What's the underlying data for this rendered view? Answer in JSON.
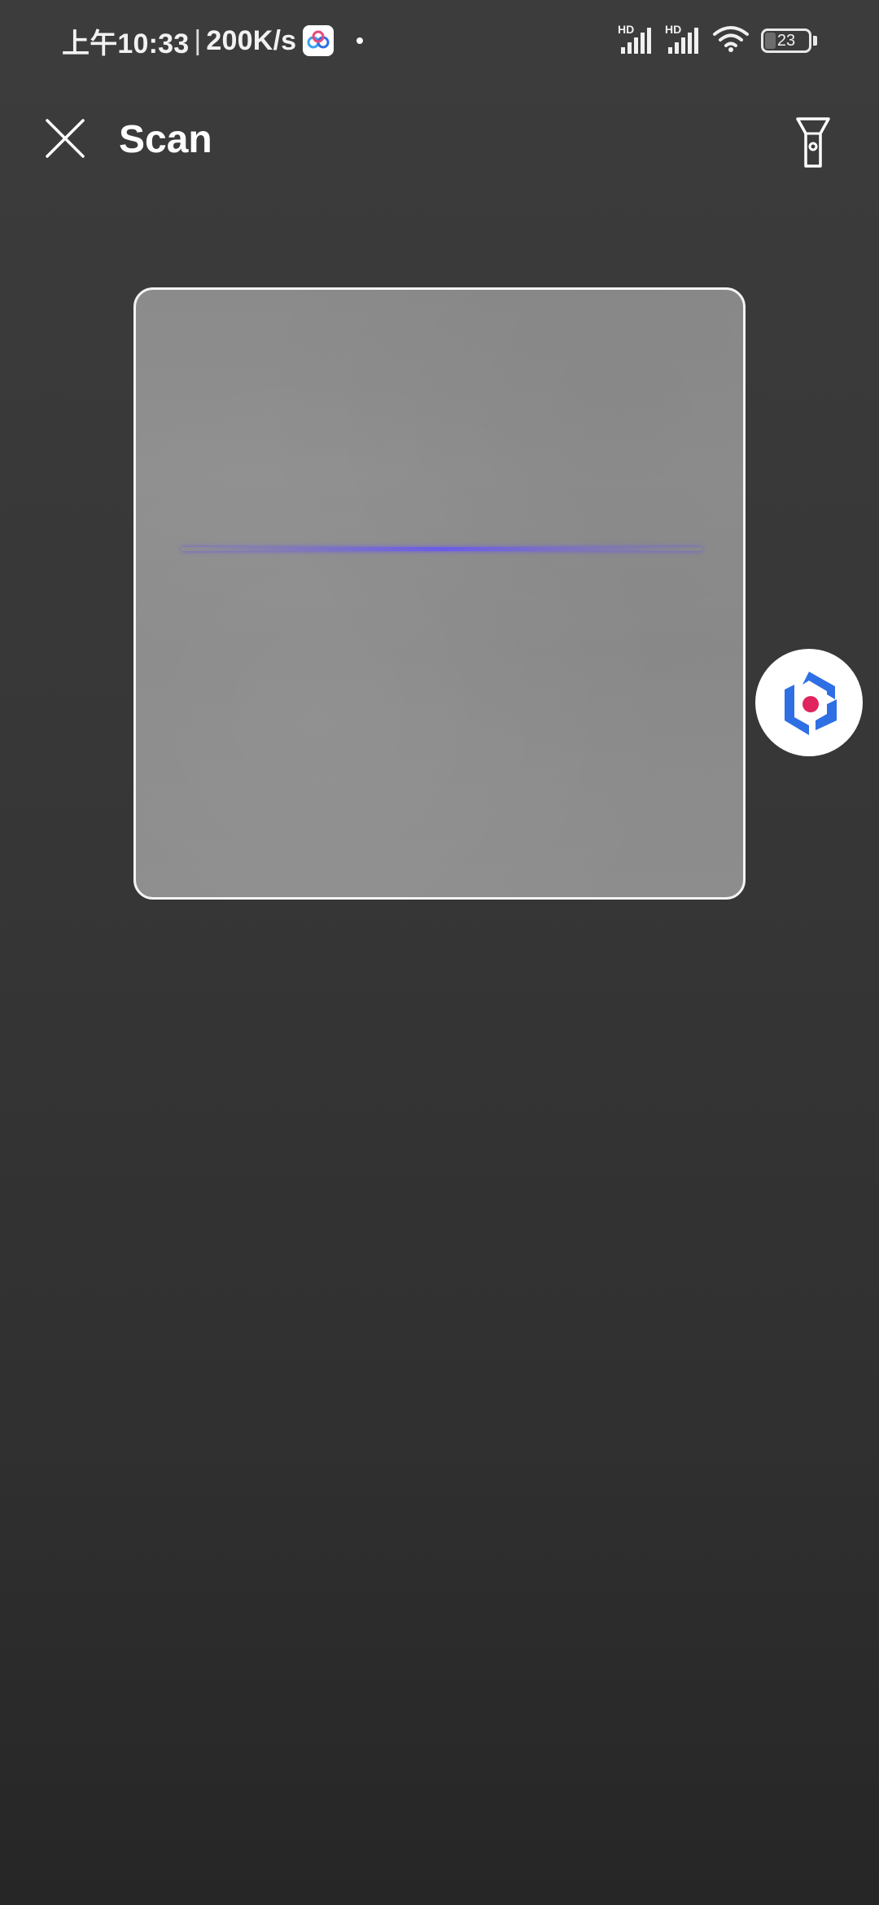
{
  "status_bar": {
    "time": "上午10:33",
    "separator": "|",
    "net_speed": "200K/s",
    "signal_1_label": "HD",
    "signal_2_label": "HD",
    "battery_level": "23",
    "battery_fraction": 0.23,
    "app_icon": "cloud-app-icon",
    "wifi_icon": "wifi-icon"
  },
  "header": {
    "title": "Scan",
    "close_icon": "close-icon",
    "flashlight_icon": "flashlight-icon"
  },
  "scanner": {
    "frame": "scan-frame",
    "line_color": "#6c5ce7"
  },
  "floating_button": {
    "icon": "assistant-logo-icon",
    "colors": {
      "primary": "#2f6fe4",
      "accent": "#e0245e"
    }
  }
}
